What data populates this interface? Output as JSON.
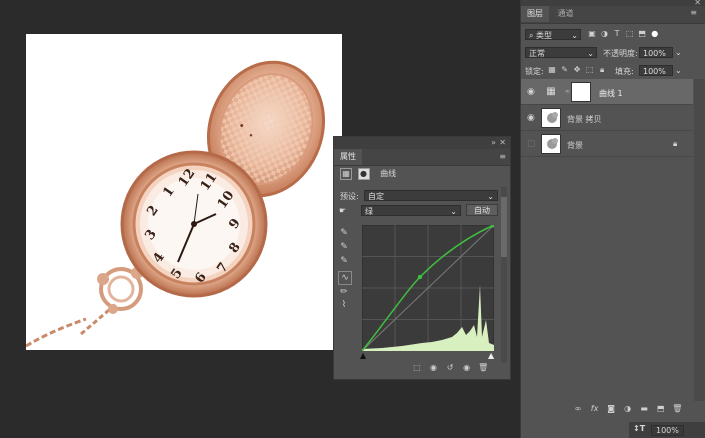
{
  "properties": {
    "tab_label": "属性",
    "adjustment_name": "曲线",
    "preset_label": "预设:",
    "preset_value": "自定",
    "channel_value": "绿",
    "auto_button": "自动"
  },
  "layers_panel": {
    "tabs": [
      {
        "label": "图层"
      },
      {
        "label": "通道"
      }
    ],
    "filter_label": "类型",
    "blend_mode": "正常",
    "opacity_label": "不透明度:",
    "opacity_value": "100%",
    "lock_label": "锁定:",
    "fill_label": "填充:",
    "fill_value": "100%",
    "layers": [
      {
        "name": "曲线 1",
        "selected": true
      },
      {
        "name": "背景 拷贝",
        "selected": false
      },
      {
        "name": "背景",
        "selected": false
      }
    ],
    "bottom_label": "100%"
  },
  "icons": {
    "visibility": "eye-icon",
    "lock": "lock-icon",
    "fx": "fx"
  },
  "colors": {
    "panel_bg": "#535353",
    "app_bg": "#2b2b2b",
    "curve_line": "#3fbf3f",
    "histogram": "#d8f0c0"
  }
}
